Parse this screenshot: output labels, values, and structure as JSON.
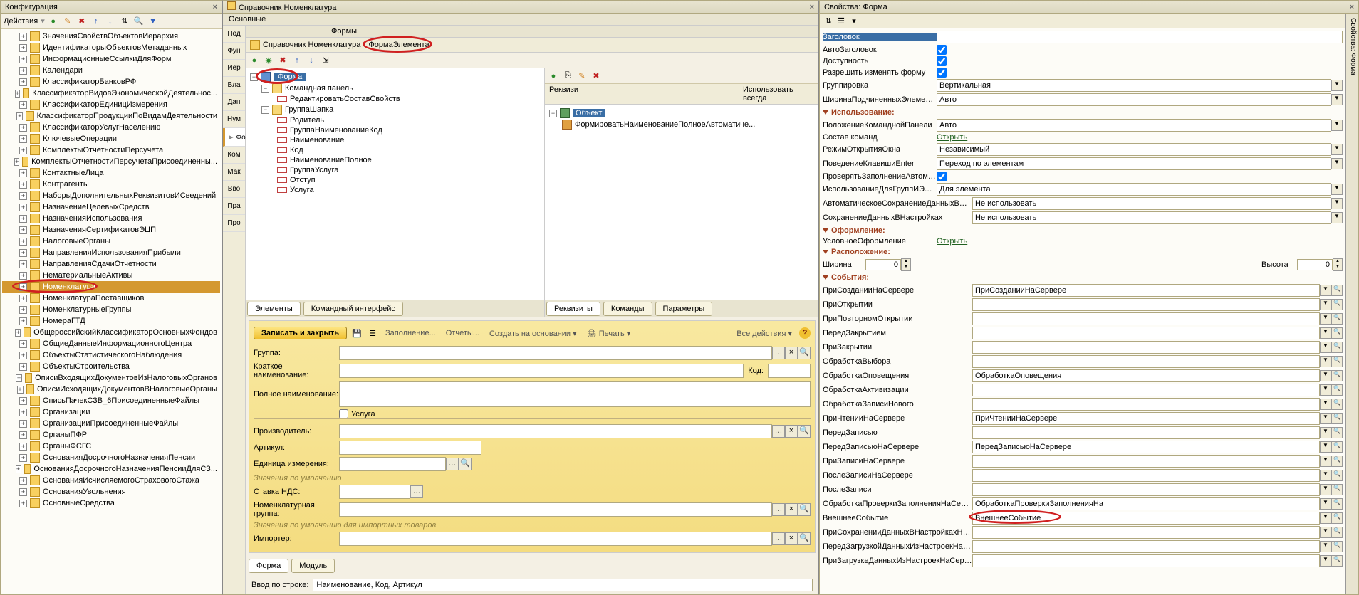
{
  "left": {
    "title": "Конфигурация",
    "actions_label": "Действия",
    "tree": [
      "ЗначенияСвойствОбъектовИерархия",
      "ИдентификаторыОбъектовМетаданных",
      "ИнформационныеСсылкиДляФорм",
      "Календари",
      "КлассификаторБанковРФ",
      "КлассификаторВидовЭкономическойДеятельнос...",
      "КлассификаторЕдиницИзмерения",
      "КлассификаторПродукцииПоВидамДеятельности",
      "КлассификаторУслугНаселению",
      "КлючевыеОперации",
      "КомплектыОтчетностиПерсучета",
      "КомплектыОтчетностиПерсучетаПрисоединенны...",
      "КонтактныеЛица",
      "Контрагенты",
      "НаборыДополнительныхРеквизитовИСведений",
      "НазначениеЦелевыхСредств",
      "НазначенияИспользования",
      "НазначенияСертификатовЭЦП",
      "НалоговыеОрганы",
      "НаправленияИспользованияПрибыли",
      "НаправленияСдачиОтчетности",
      "НематериальныеАктивы",
      "Номенклатура",
      "НоменклатураПоставщиков",
      "НоменклатурныеГруппы",
      "НомераГТД",
      "ОбщероссийскийКлассификаторОсновныхФондов",
      "ОбщиеДанныеИнформационногоЦентра",
      "ОбъектыСтатистическогоНаблюдения",
      "ОбъектыСтроительства",
      "ОписиВходящихДокументовИзНалоговыхОрганов",
      "ОписиИсходящихДокументовВНалоговыеОрганы",
      "ОписьПачекСЗВ_6ПрисоединенныеФайлы",
      "Организации",
      "ОрганизацииПрисоединенныеФайлы",
      "ОрганыПФР",
      "ОрганыФСГС",
      "ОснованияДосрочногоНазначенияПенсии",
      "ОснованияДосрочногоНазначенияПенсииДляСЗ...",
      "ОснованияИсчисляемогоСтраховогоСтажа",
      "ОснованияУвольнения",
      "ОсновныеСредства"
    ],
    "selected_index": 22
  },
  "center": {
    "title": "Справочник Номенклатура",
    "sub1": "Основные",
    "sub2": "Формы",
    "breadcrumb1": "Справочник Номенклатура",
    "breadcrumb2": "ФормаЭлемента",
    "side_tabs": [
      "Под",
      "Фун",
      "Иер",
      "Вла",
      "Дан",
      "Нум",
      "Фор",
      "Ком",
      "Мак",
      "Вво",
      "Пра",
      "Про"
    ],
    "side_active": 6,
    "elem_tree": {
      "root": "Форма",
      "items": [
        {
          "label": "Командная панель",
          "children": [
            "РедактироватьСоставСвойств"
          ]
        },
        {
          "label": "ГруппаШапка",
          "children": [
            "Родитель",
            "ГруппаНаименованиеКод",
            "Наименование",
            "Код",
            "НаименованиеПолное",
            "ГруппаУслуга",
            "Отступ",
            "Услуга"
          ]
        }
      ]
    },
    "req_header1": "Реквизит",
    "req_header2": "Использовать всегда",
    "req_obj": "Объект",
    "req_item": "ФормироватьНаименованиеПолноеАвтоматиче...",
    "btabs_left": [
      "Элементы",
      "Командный интерфейс"
    ],
    "btabs_right": [
      "Реквизиты",
      "Команды",
      "Параметры"
    ],
    "preview": {
      "save_btn": "Записать и закрыть",
      "menu": [
        "Заполнение...",
        "Отчеты...",
        "Создать на основании",
        "Печать"
      ],
      "all_actions": "Все действия",
      "fields": {
        "group": "Группа:",
        "short_name": "Краткое наименование:",
        "code": "Код:",
        "full_name": "Полное наименование:",
        "service": "Услуга",
        "manufacturer": "Производитель:",
        "article": "Артикул:",
        "unit": "Единица измерения:",
        "defaults": "Значения по умолчанию",
        "vat": "Ставка НДС:",
        "nom_group": "Номенклатурная группа:",
        "import_defaults": "Значения по умолчанию для импортных товаров",
        "importer": "Импортер:"
      }
    },
    "bottom_tabs": [
      "Форма",
      "Модуль"
    ],
    "find_label": "Ввод по строке:",
    "find_value": "Наименование, Код, Артикул"
  },
  "right": {
    "title": "Свойства: Форма",
    "side_label": "Свойства: Форма",
    "groups": {
      "basic": [
        {
          "label": "Заголовок",
          "value": "",
          "type": "text",
          "selected": true
        },
        {
          "label": "АвтоЗаголовок",
          "value": true,
          "type": "check"
        },
        {
          "label": "Доступность",
          "value": true,
          "type": "check"
        },
        {
          "label": "Разрешить изменять форму",
          "value": true,
          "type": "check"
        },
        {
          "label": "Группировка",
          "value": "Вертикальная",
          "type": "dd"
        },
        {
          "label": "ШиринаПодчиненныхЭлементов",
          "value": "Авто",
          "type": "dd"
        }
      ],
      "usage_title": "Использование:",
      "usage": [
        {
          "label": "ПоложениеКоманднойПанели",
          "value": "Авто",
          "type": "dd"
        },
        {
          "label": "Состав команд",
          "value": "Открыть",
          "type": "link"
        },
        {
          "label": "РежимОткрытияОкна",
          "value": "Независимый",
          "type": "dd"
        },
        {
          "label": "ПоведениеКлавишиEnter",
          "value": "Переход по элементам",
          "type": "dd"
        },
        {
          "label": "ПроверятьЗаполнениеАвтоматически",
          "value": true,
          "type": "check"
        },
        {
          "label": "ИспользованиеДляГруппИЭлементов",
          "value": "Для элемента",
          "type": "dd"
        },
        {
          "label": "АвтоматическоеСохранениеДанныхВНастройках",
          "value": "Не использовать",
          "type": "dd",
          "wide": true
        },
        {
          "label": "СохранениеДанныхВНастройках",
          "value": "Не использовать",
          "type": "dd",
          "wide": true
        }
      ],
      "design_title": "Оформление:",
      "design": [
        {
          "label": "УсловноеОформление",
          "value": "Открыть",
          "type": "link"
        }
      ],
      "layout_title": "Расположение:",
      "layout": {
        "width_label": "Ширина",
        "width_value": "0",
        "height_label": "Высота",
        "height_value": "0"
      },
      "events_title": "События:",
      "events": [
        {
          "label": "ПриСозданииНаСервере",
          "value": "ПриСозданииНаСервере"
        },
        {
          "label": "ПриОткрытии",
          "value": ""
        },
        {
          "label": "ПриПовторномОткрытии",
          "value": ""
        },
        {
          "label": "ПередЗакрытием",
          "value": ""
        },
        {
          "label": "ПриЗакрытии",
          "value": ""
        },
        {
          "label": "ОбработкаВыбора",
          "value": ""
        },
        {
          "label": "ОбработкаОповещения",
          "value": "ОбработкаОповещения"
        },
        {
          "label": "ОбработкаАктивизации",
          "value": ""
        },
        {
          "label": "ОбработкаЗаписиНового",
          "value": ""
        },
        {
          "label": "ПриЧтенииНаСервере",
          "value": "ПриЧтенииНаСервере"
        },
        {
          "label": "ПередЗаписью",
          "value": ""
        },
        {
          "label": "ПередЗаписьюНаСервере",
          "value": "ПередЗаписьюНаСервере"
        },
        {
          "label": "ПриЗаписиНаСервере",
          "value": ""
        },
        {
          "label": "ПослеЗаписиНаСервере",
          "value": ""
        },
        {
          "label": "ПослеЗаписи",
          "value": ""
        },
        {
          "label": "ОбработкаПроверкиЗаполненияНаСервере",
          "value": "ОбработкаПроверкиЗаполненияНа"
        },
        {
          "label": "ВнешнееСобытие",
          "value": "ВнешнееСобытие",
          "highlight": true
        },
        {
          "label": "ПриСохраненииДанныхВНастройкахНаСервере",
          "value": ""
        },
        {
          "label": "ПередЗагрузкойДанныхИзНастроекНаСервере",
          "value": ""
        },
        {
          "label": "ПриЗагрузкеДанныхИзНастроекНаСервере",
          "value": ""
        }
      ]
    }
  }
}
